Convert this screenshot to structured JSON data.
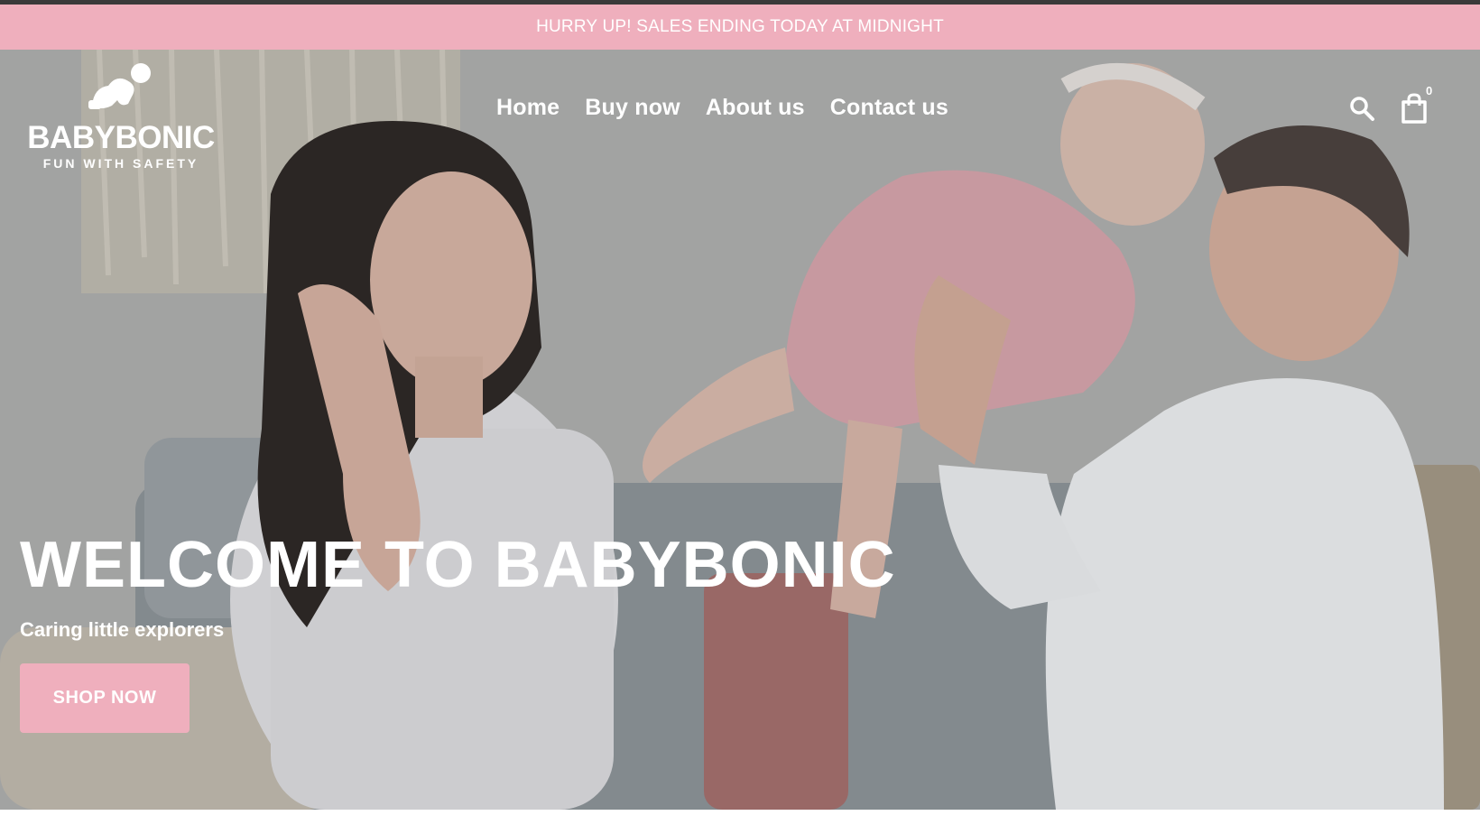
{
  "announcement": {
    "text": "HURRY UP! SALES ENDING TODAY AT MIDNIGHT"
  },
  "brand": {
    "name": "BABYBONIC",
    "tagline": "FUN WITH SAFETY"
  },
  "nav": {
    "items": [
      {
        "label": "Home"
      },
      {
        "label": "Buy now"
      },
      {
        "label": "About us"
      },
      {
        "label": "Contact us"
      }
    ]
  },
  "header": {
    "search_icon": "search-icon",
    "cart_icon": "shopping-bag-icon",
    "cart_count": "0"
  },
  "hero": {
    "title": "WELCOME TO BABYBONIC",
    "subtitle": "Caring little explorers",
    "cta_label": "SHOP NOW"
  },
  "colors": {
    "accent": "#efafbd",
    "text_light": "#ffffff",
    "topline": "#3a3a3a"
  }
}
